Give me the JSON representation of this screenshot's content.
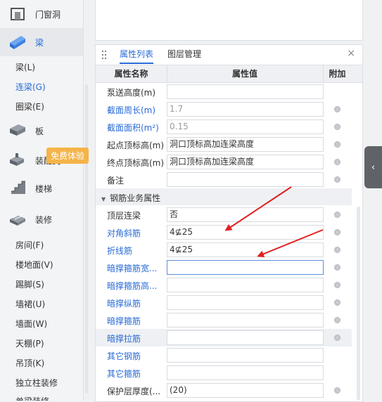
{
  "sidebar": {
    "categories": [
      {
        "label": "门窗洞",
        "icon": "door-window-icon"
      },
      {
        "label": "梁",
        "icon": "beam-icon",
        "active": true
      },
      {
        "label": "板",
        "icon": "slab-icon"
      },
      {
        "label": "装配式",
        "icon": "prefab-icon"
      },
      {
        "label": "楼梯",
        "icon": "stair-icon"
      },
      {
        "label": "装修",
        "icon": "decoration-icon"
      }
    ],
    "beam_items": [
      "梁(L)",
      "连梁(G)",
      "圈梁(E)"
    ],
    "decoration_items": [
      "房间(F)",
      "楼地面(V)",
      "踢脚(S)",
      "墙裙(U)",
      "墙面(W)",
      "天棚(P)",
      "吊顶(K)",
      "独立柱装修",
      "单梁装修"
    ],
    "tooltip": "免费体验"
  },
  "panel": {
    "tabs": [
      "属性列表",
      "图层管理"
    ],
    "close_symbol": "×",
    "header": {
      "name": "属性名称",
      "value": "属性值",
      "extra": "附加"
    },
    "rows_top": [
      {
        "name": "泵送高度(m)",
        "value": "",
        "blue": false,
        "gray": false,
        "dot": false
      },
      {
        "name": "截面周长(m)",
        "value": "1.7",
        "blue": true,
        "gray": true,
        "dot": true
      },
      {
        "name": "截面面积(m²)",
        "value": "0.15",
        "blue": true,
        "gray": true,
        "dot": true
      },
      {
        "name": "起点顶标高(m)",
        "value": "洞口顶标高加连梁高度",
        "blue": false,
        "gray": false,
        "dot": true
      },
      {
        "name": "终点顶标高(m)",
        "value": "洞口顶标高加连梁高度",
        "blue": false,
        "gray": false,
        "dot": true
      },
      {
        "name": "备注",
        "value": "",
        "blue": false,
        "gray": false,
        "dot": true
      }
    ],
    "section_label": "钢筋业务属性",
    "rows_rebar": [
      {
        "name": "顶层连梁",
        "value": "否",
        "blue": false,
        "dot": true
      },
      {
        "name": "对角斜筋",
        "value": "4⊈25",
        "blue": true,
        "dot": true
      },
      {
        "name": "折线筋",
        "value": "4⊈25",
        "blue": true,
        "dot": true
      },
      {
        "name": "暗撑箍筋宽...",
        "value": "",
        "blue": true,
        "dot": true,
        "focused": true
      },
      {
        "name": "暗撑箍筋高...",
        "value": "",
        "blue": true,
        "dot": true
      },
      {
        "name": "暗撑纵筋",
        "value": "",
        "blue": true,
        "dot": true
      },
      {
        "name": "暗撑箍筋",
        "value": "",
        "blue": true,
        "dot": true
      },
      {
        "name": "暗撑拉筋",
        "value": "",
        "blue": true,
        "dot": true
      },
      {
        "name": "其它钢筋",
        "value": "",
        "blue": true,
        "dot": false
      },
      {
        "name": "其它箍筋",
        "value": "",
        "blue": true,
        "dot": false
      },
      {
        "name": "保护层厚度(...",
        "value": "(20)",
        "blue": false,
        "dot": true
      }
    ]
  },
  "colors": {
    "accent": "#2a6bd6",
    "annotation": "#e02020",
    "tooltip": "#f4b449"
  }
}
